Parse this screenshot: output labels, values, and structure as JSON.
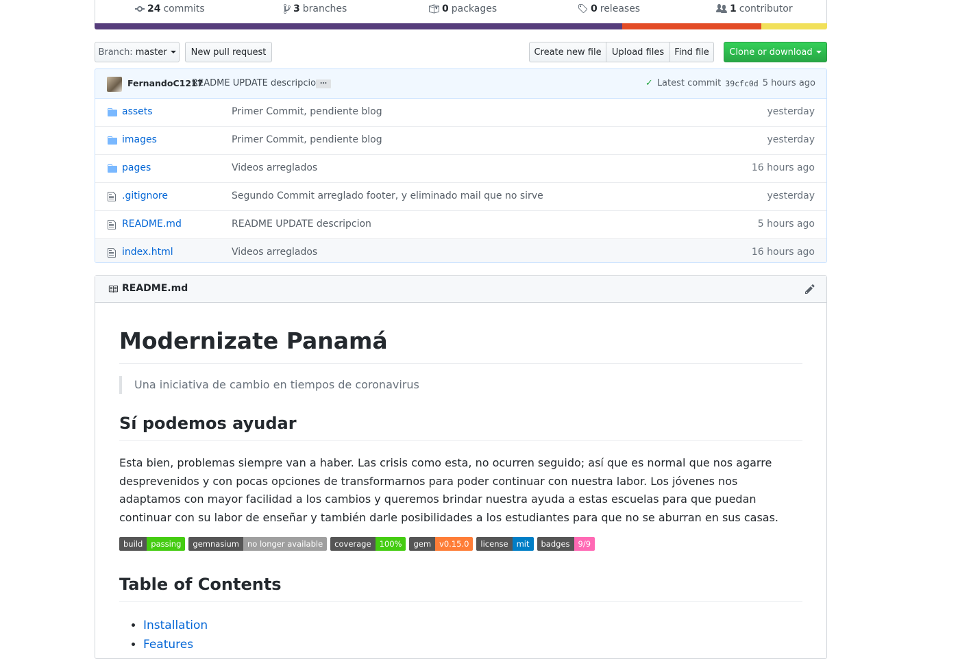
{
  "summary": {
    "commits_count": "24",
    "commits_label": "commits",
    "branches_count": "3",
    "branches_label": "branches",
    "packages_count": "0",
    "packages_label": "packages",
    "releases_count": "0",
    "releases_label": "releases",
    "contributors_count": "1",
    "contributors_label": "contributor"
  },
  "language_bar": [
    {
      "color": "#563d7c",
      "share": 0.72
    },
    {
      "color": "#e34c26",
      "share": 0.19
    },
    {
      "color": "#f1e05a",
      "share": 0.09
    }
  ],
  "toolbar": {
    "branch_prefix": "Branch:",
    "branch_name": "master",
    "new_pr": "New pull request",
    "create_file": "Create new file",
    "upload_files": "Upload files",
    "find_file": "Find file",
    "clone": "Clone or download"
  },
  "latest_commit": {
    "author": "FernandoC1217",
    "message": "README UPDATE descripcion",
    "ellipsis": "…",
    "label": "Latest commit",
    "sha": "39cfc0d",
    "age": "5 hours ago"
  },
  "files": [
    {
      "type": "dir",
      "name": "assets",
      "message": "Primer Commit, pendiente blog",
      "age": "yesterday"
    },
    {
      "type": "dir",
      "name": "images",
      "message": "Primer Commit, pendiente blog",
      "age": "yesterday"
    },
    {
      "type": "dir",
      "name": "pages",
      "message": "Videos arreglados",
      "age": "16 hours ago"
    },
    {
      "type": "file",
      "name": ".gitignore",
      "message": "Segundo Commit arreglado footer, y eliminado mail que no sirve",
      "age": "yesterday"
    },
    {
      "type": "file",
      "name": "README.md",
      "message": "README UPDATE descripcion",
      "age": "5 hours ago"
    },
    {
      "type": "file",
      "name": "index.html",
      "message": "Videos arreglados",
      "age": "16 hours ago"
    }
  ],
  "readme": {
    "filename": "README.md",
    "h1": "Modernizate Panamá",
    "quote": "Una iniciativa de cambio en tiempos de coronavirus",
    "h2_help": "Sí podemos ayudar",
    "paragraph": "Esta bien, problemas siempre van a haber. Las crisis como esta, no ocurren seguido; así que es normal que nos agarre desprevenidos y con pocas opciones de transformarnos para poder continuar con nuestra labor. Los jóvenes nos adaptamos con mayor facilidad a los cambios y queremos brindar nuestra ayuda a estas escuelas para que puedan continuar con su labor de enseñar y también darle posibilidades a los estudiantes para que no se aburran en sus casas.",
    "badges": [
      {
        "label": "build",
        "value": "passing",
        "color": "#4c1"
      },
      {
        "label": "gemnasium",
        "value": "no longer available",
        "color": "#9f9f9f"
      },
      {
        "label": "coverage",
        "value": "100%",
        "color": "#4c1"
      },
      {
        "label": "gem",
        "value": "v0.15.0",
        "color": "#fe7d37"
      },
      {
        "label": "license",
        "value": "mit",
        "color": "#007ec6"
      },
      {
        "label": "badges",
        "value": "9/9",
        "color": "#ff69b4"
      }
    ],
    "h2_toc": "Table of Contents",
    "toc": [
      "Installation",
      "Features"
    ]
  }
}
